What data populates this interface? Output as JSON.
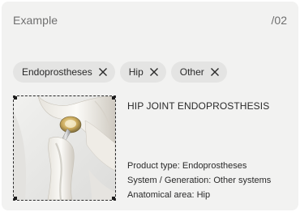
{
  "card": {
    "title": "Example",
    "index": "/02"
  },
  "filters": [
    {
      "label": "Endoprostheses",
      "icon": "close-icon"
    },
    {
      "label": "Hip",
      "icon": "close-icon"
    },
    {
      "label": "Other",
      "icon": "close-icon"
    }
  ],
  "product": {
    "title": "HIP JOINT ENDOPROSTHESIS",
    "image_alt": "hip joint endoprosthesis",
    "product_type": "Product type: Endoprostheses",
    "system_generation": "System / Generation: Other systems",
    "anatomical_area": "Anatomical area: Hip"
  },
  "colors": {
    "card_bg": "#f2f2f1",
    "chip_bg": "#e4e4e3",
    "text": "#2a2a2a",
    "muted": "#6f6f6f"
  }
}
